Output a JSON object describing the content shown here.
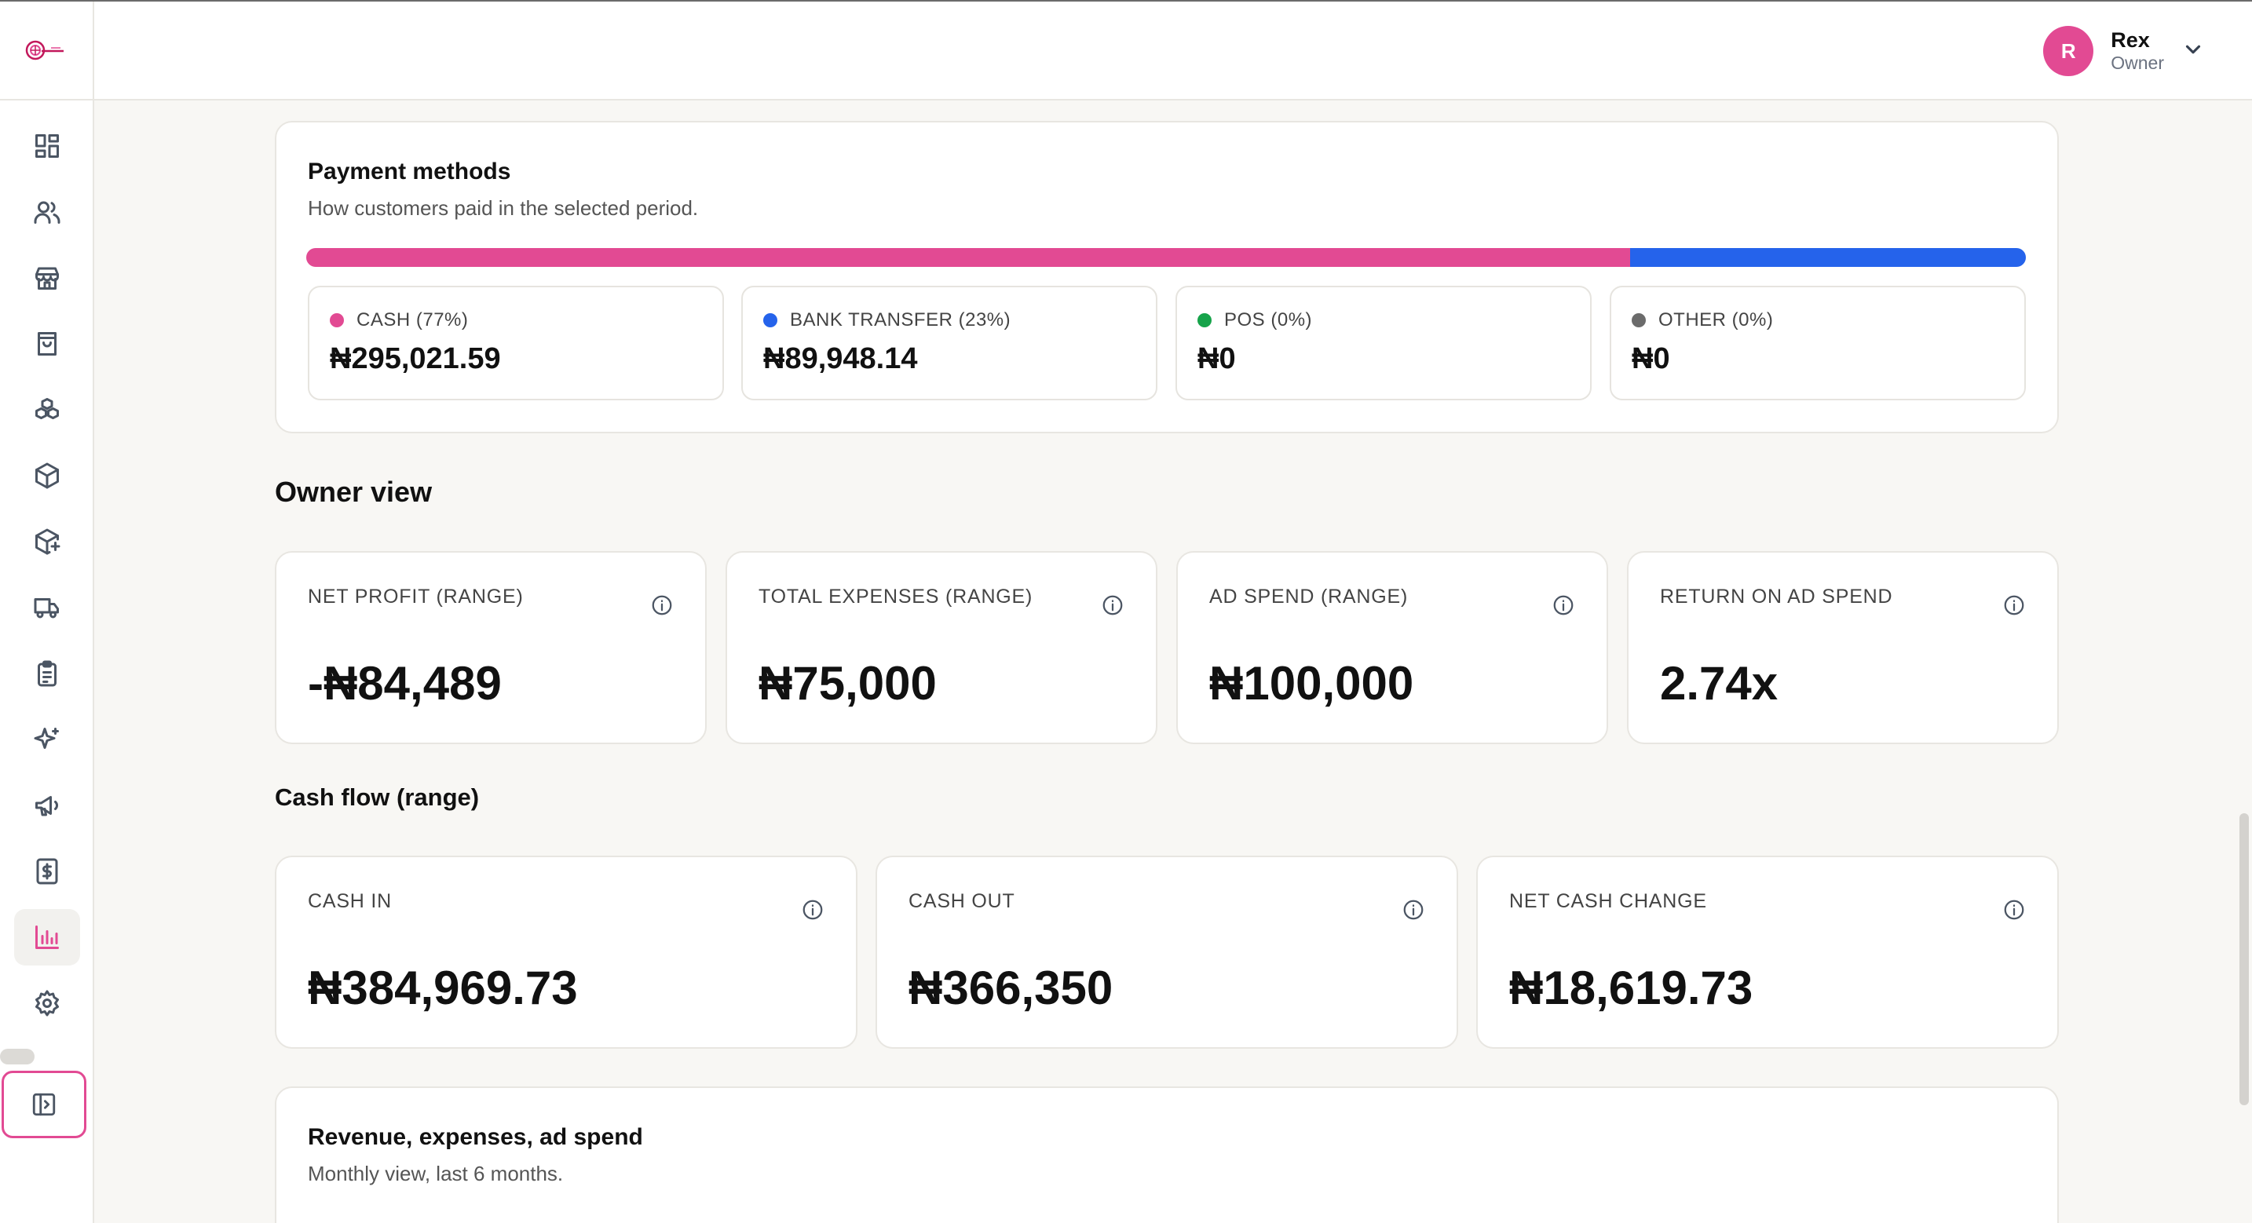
{
  "user": {
    "initial": "R",
    "name": "Rex",
    "role": "Owner"
  },
  "colors": {
    "accent": "#e24a93",
    "cash": "#e24a93",
    "bank": "#2563eb",
    "pos": "#16a34a",
    "other": "#6b6b6b"
  },
  "payment_methods": {
    "title": "Payment methods",
    "subtitle": "How customers paid in the selected period.",
    "share_percent": {
      "cash": 77,
      "bank": 23,
      "pos": 0,
      "other": 0
    },
    "items": [
      {
        "label": "CASH (77%)",
        "value": "₦295,021.59"
      },
      {
        "label": "BANK TRANSFER (23%)",
        "value": "₦89,948.14"
      },
      {
        "label": "POS (0%)",
        "value": "₦0"
      },
      {
        "label": "OTHER (0%)",
        "value": "₦0"
      }
    ]
  },
  "owner_view": {
    "title": "Owner view",
    "metrics": [
      {
        "label": "NET PROFIT (RANGE)",
        "value": "-₦84,489"
      },
      {
        "label": "TOTAL EXPENSES (RANGE)",
        "value": "₦75,000"
      },
      {
        "label": "AD SPEND (RANGE)",
        "value": "₦100,000"
      },
      {
        "label": "RETURN ON AD SPEND",
        "value": "2.74x"
      }
    ]
  },
  "cash_flow": {
    "title": "Cash flow (range)",
    "metrics": [
      {
        "label": "CASH IN",
        "value": "₦384,969.73"
      },
      {
        "label": "CASH OUT",
        "value": "₦366,350"
      },
      {
        "label": "NET CASH CHANGE",
        "value": "₦18,619.73"
      }
    ]
  },
  "revenue_chart": {
    "title": "Revenue, expenses, ad spend",
    "subtitle": "Monthly view, last 6 months."
  },
  "nav_icons": [
    "dashboard-icon",
    "users-icon",
    "store-icon",
    "shopping-bag-icon",
    "boxes-icon",
    "package-icon",
    "package-plus-icon",
    "truck-icon",
    "clipboard-list-icon",
    "sparkles-icon",
    "megaphone-icon",
    "dollar-receipt-icon",
    "bar-chart-icon",
    "gear-icon"
  ]
}
